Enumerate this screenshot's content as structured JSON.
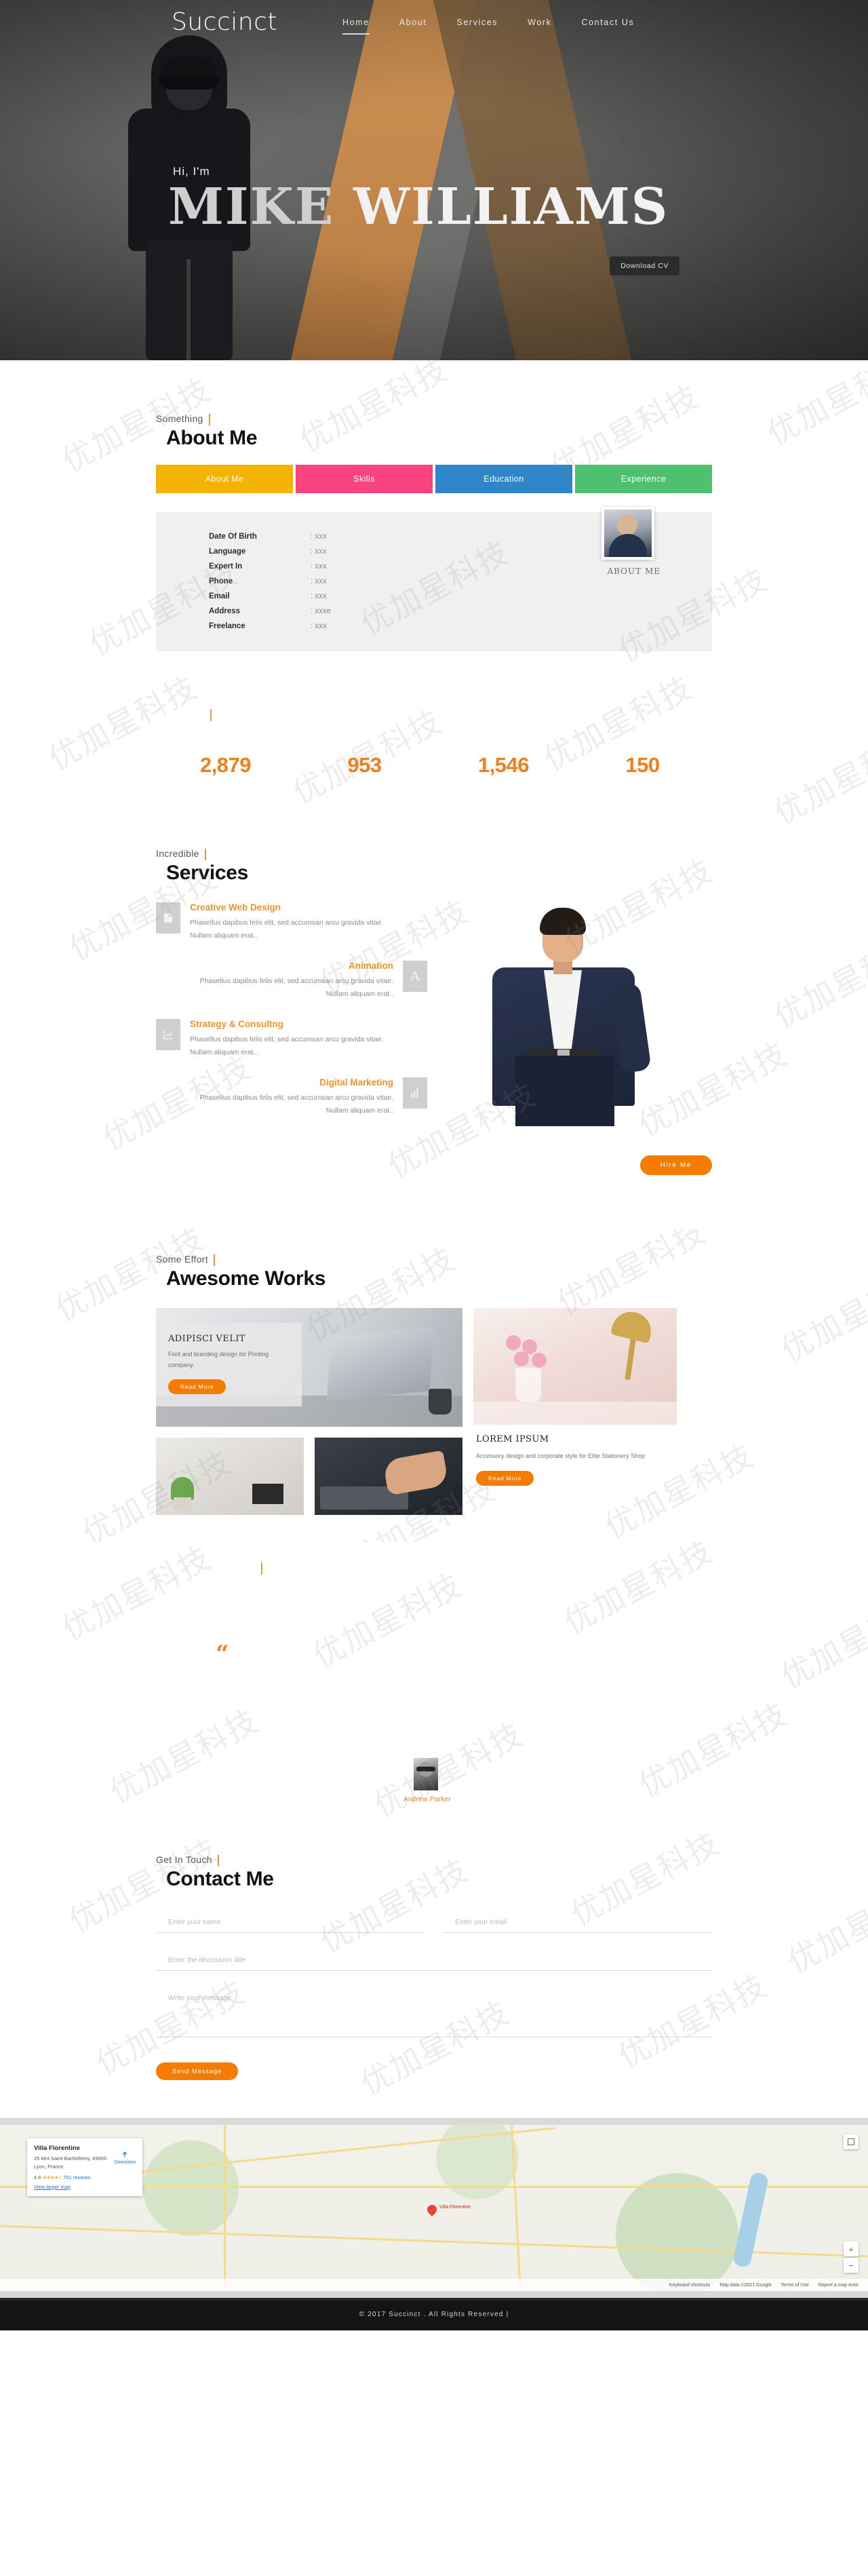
{
  "brand": "Succinct",
  "nav": {
    "items": [
      {
        "label": "Home",
        "active": true
      },
      {
        "label": "About",
        "active": false
      },
      {
        "label": "Services",
        "active": false
      },
      {
        "label": "Work",
        "active": false
      },
      {
        "label": "Contact Us",
        "active": false
      }
    ]
  },
  "hero": {
    "greeting": "Hi, I'm",
    "name_part1": "MIKE",
    "name_part2": "WILLIAMS",
    "cta": "Download CV"
  },
  "about": {
    "subtitle": "Something",
    "title": "About Me",
    "tabs": [
      {
        "label": "About Me",
        "color": "#f5b301"
      },
      {
        "label": "Skills",
        "color": "#f9447f"
      },
      {
        "label": "Education",
        "color": "#2e86c8"
      },
      {
        "label": "Experience",
        "color": "#4ec16e"
      }
    ],
    "info": [
      {
        "label": "Date Of Birth",
        "value": ": xxx"
      },
      {
        "label": "Language",
        "value": ": xxx"
      },
      {
        "label": "Expert In",
        "value": ": xxx"
      },
      {
        "label": "Phone",
        "value": ": xxx"
      },
      {
        "label": "Email",
        "value": ": xxx"
      },
      {
        "label": "Address",
        "value": ": xxxe"
      },
      {
        "label": "Freelance",
        "value": ": xxx"
      }
    ],
    "photo_caption": "ABOUT ME"
  },
  "counters": [
    {
      "number": "2,879",
      "label": ""
    },
    {
      "number": "953",
      "label": ""
    },
    {
      "number": "1,546",
      "label": ""
    },
    {
      "number": "150",
      "label": ""
    }
  ],
  "services": {
    "subtitle": "Incredible",
    "title": "Services",
    "items": [
      {
        "name": "Creative Web Design",
        "desc": "Phasellus dapibus felis elit, sed accumsan arcu gravida vitae. Nullam aliquam erat..",
        "icon": "image-icon",
        "align": "left"
      },
      {
        "name": "Animation",
        "desc": "Phasellus dapibus felis elit, sed accumsan arcu gravida vitae. Nullam aliquam erat..",
        "icon": "letter-a-icon",
        "align": "right"
      },
      {
        "name": "Strategy & Consultng",
        "desc": "Phasellus dapibus felis elit, sed accumsan arcu gravida vitae. Nullam aliquam erat..",
        "icon": "line-chart-icon",
        "align": "left"
      },
      {
        "name": "Digital Marketing",
        "desc": "Phasellus dapibus felis elit, sed accumsan arcu gravida vitae. Nullam aliquam erat..",
        "icon": "bar-chart-icon",
        "align": "right"
      }
    ],
    "hire_button": "Hire Me"
  },
  "works": {
    "subtitle": "Some Effort",
    "title": "Awesome Works",
    "featured": {
      "title": "ADIPISCI VELIT",
      "desc": "Font and branding design for Printing company.",
      "button": "Read More"
    },
    "card": {
      "title": "LOREM IPSUM",
      "desc": "Accessory design and corporate style for Elite Stationery Shop",
      "button": "Read More"
    }
  },
  "testimonial": {
    "quote_glyph": "“",
    "author": "Andrew Parker"
  },
  "contact": {
    "subtitle": "Get In Touch",
    "title": "Contact Me",
    "name_placeholder": "Enter your name",
    "email_placeholder": "Enter your email",
    "subject_placeholder": "Enter the discussion title",
    "message_placeholder": "Write your message",
    "send_button": "Send Message"
  },
  "map": {
    "place_name": "Villa Florentine",
    "address_line1": "25 Mnt Saint-Barthélémy, 69005",
    "address_line2": "Lyon, France",
    "rating": "4.6",
    "stars": "★★★★☆",
    "reviews": "701 reviews",
    "larger_map_link": "View larger map",
    "directions_label": "Directions",
    "pin_label": "Villa Florentine",
    "bottom_bar": [
      "Keyboard shortcuts",
      "Map data ©2021 Google",
      "Terms of Use",
      "Report a map error"
    ],
    "zoom_in": "+",
    "zoom_out": "−"
  },
  "footer": {
    "text": "© 2017 Succinct . All Rights Reserved |"
  },
  "watermark": "优加星科技"
}
